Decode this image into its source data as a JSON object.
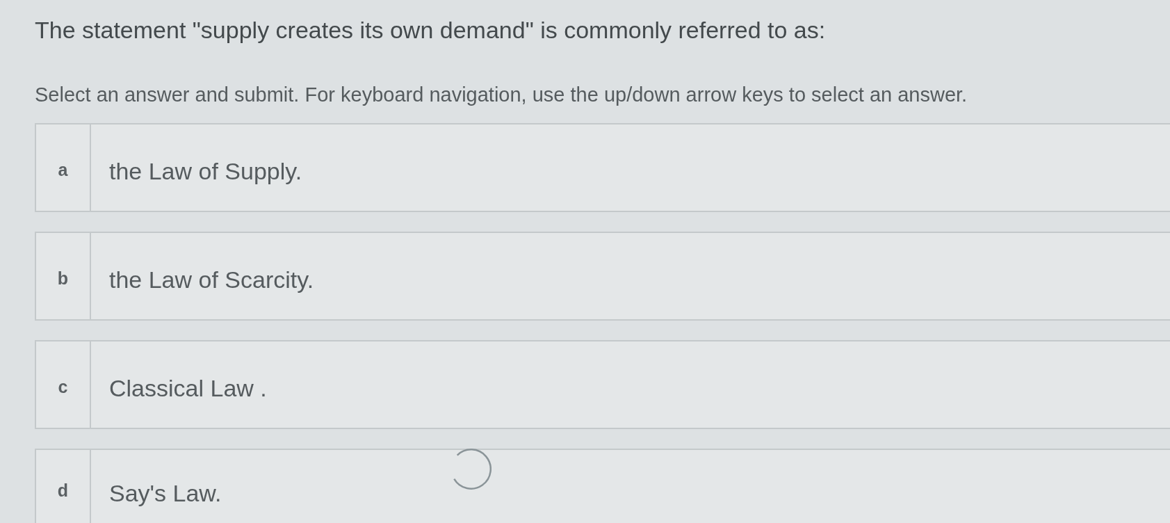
{
  "question": {
    "text": "The statement \"supply creates its own demand\" is commonly referred to as:"
  },
  "instructions": "Select an answer and submit. For keyboard navigation, use the up/down arrow keys to select an answer.",
  "options": [
    {
      "letter": "a",
      "text": "the Law of Supply.",
      "selected": false
    },
    {
      "letter": "b",
      "text": "the Law of Scarcity.",
      "selected": false
    },
    {
      "letter": "c",
      "text": "Classical Law .",
      "selected": false
    },
    {
      "letter": "d",
      "text": "Say's Law.",
      "selected": false
    }
  ],
  "loading": true
}
